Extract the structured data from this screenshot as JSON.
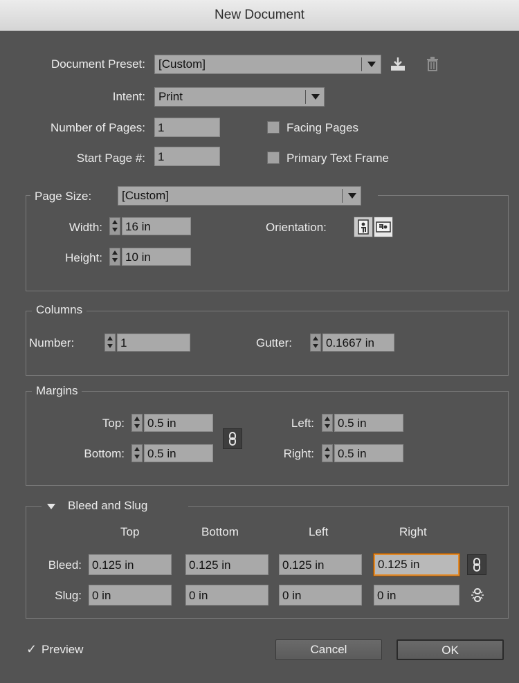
{
  "window": {
    "title": "New Document"
  },
  "document": {
    "preset_label": "Document Preset:",
    "preset_value": "[Custom]",
    "intent_label": "Intent:",
    "intent_value": "Print",
    "pages_label": "Number of Pages:",
    "pages_value": "1",
    "start_label": "Start Page #:",
    "start_value": "1",
    "facing_label": "Facing Pages",
    "facing_checked": false,
    "primary_label": "Primary Text Frame",
    "primary_checked": false
  },
  "page_size": {
    "label": "Page Size:",
    "value": "[Custom]",
    "width_label": "Width:",
    "width_value": "16 in",
    "height_label": "Height:",
    "height_value": "10 in",
    "orientation_label": "Orientation:",
    "orientation_selected": "landscape"
  },
  "columns": {
    "title": "Columns",
    "number_label": "Number:",
    "number_value": "1",
    "gutter_label": "Gutter:",
    "gutter_value": "0.1667 in"
  },
  "margins": {
    "title": "Margins",
    "top_label": "Top:",
    "top_value": "0.5 in",
    "bottom_label": "Bottom:",
    "bottom_value": "0.5 in",
    "left_label": "Left:",
    "left_value": "0.5 in",
    "right_label": "Right:",
    "right_value": "0.5 in"
  },
  "bleed_slug": {
    "title": "Bleed and Slug",
    "headers": [
      "Top",
      "Bottom",
      "Left",
      "Right"
    ],
    "bleed_label": "Bleed:",
    "bleed_values": [
      "0.125 in",
      "0.125 in",
      "0.125 in",
      "0.125 in"
    ],
    "slug_label": "Slug:",
    "slug_values": [
      "0 in",
      "0 in",
      "0 in",
      "0 in"
    ]
  },
  "footer": {
    "preview_label": "Preview",
    "preview_checked": true,
    "cancel_label": "Cancel",
    "ok_label": "OK"
  }
}
